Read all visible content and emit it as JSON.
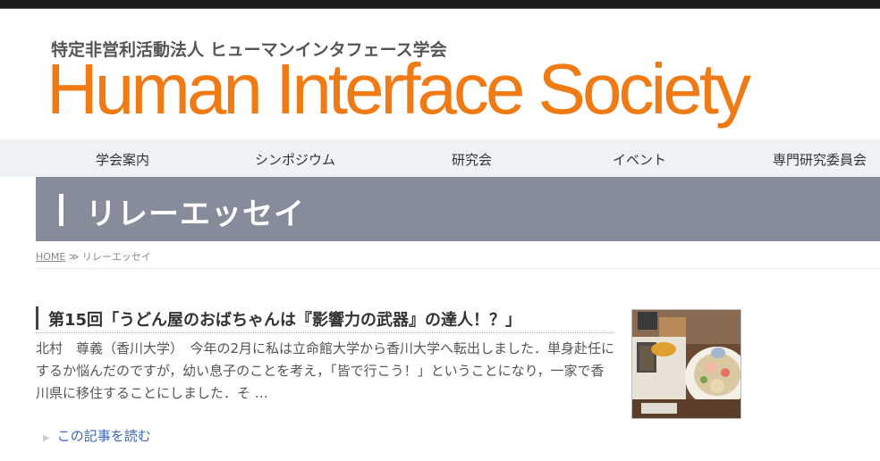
{
  "header": {
    "org_name": "特定非営利活動法人 ヒューマンインタフェース学会",
    "logo_text": "Human Interface Society",
    "logo_color": "#f07a14"
  },
  "nav": {
    "items": [
      {
        "label": "学会案内"
      },
      {
        "label": "シンポジウム"
      },
      {
        "label": "研究会"
      },
      {
        "label": "イベント"
      },
      {
        "label": "専門研究委員会"
      }
    ]
  },
  "banner": {
    "title": "リレーエッセイ",
    "background_color": "#868c9a"
  },
  "breadcrumb": {
    "home": "HOME",
    "separator": "≫",
    "current": "リレーエッセイ"
  },
  "post": {
    "title": "第15回「うどん屋のおばちゃんは『影響力の武器』の達人！？」",
    "excerpt": "北村　尊義（香川大学）　今年の2月に私は立命館大学から香川大学へ転出しました．単身赴任にするか悩んだのですが，幼い息子のことを考え，「皆で行こう！」ということになり，一家で香川県に移住することにしました．そ …",
    "read_more": "この記事を読む"
  }
}
